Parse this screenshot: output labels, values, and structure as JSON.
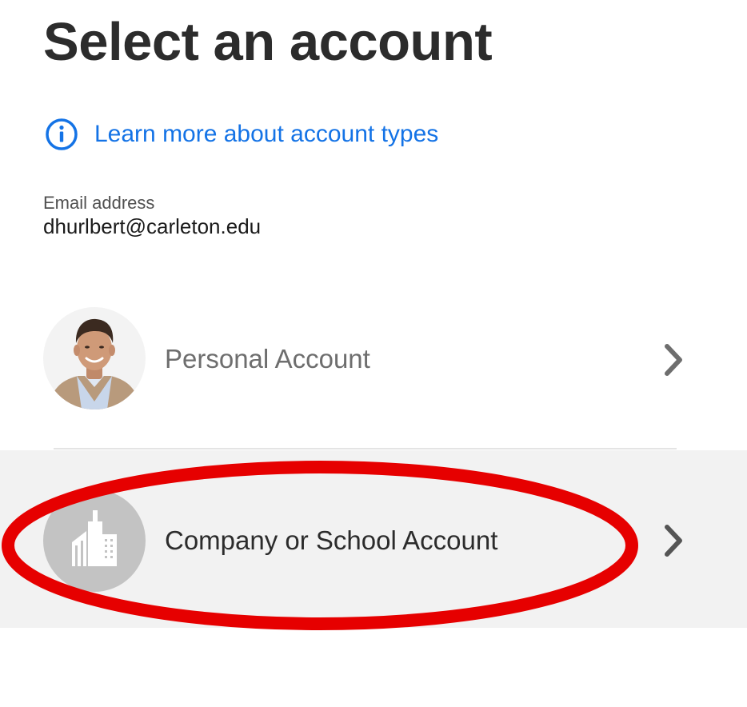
{
  "header": {
    "title": "Select an account"
  },
  "help": {
    "icon": "info-icon",
    "link_text": "Learn more about account types",
    "link_color": "#1473e6"
  },
  "email": {
    "label": "Email address",
    "value": "dhurlbert@carleton.edu"
  },
  "accounts": [
    {
      "label": "Personal Account",
      "avatar": "user-photo",
      "chevron": "chevron-right-icon"
    },
    {
      "label": "Company or School Account",
      "avatar": "building-icon",
      "chevron": "chevron-right-icon"
    }
  ],
  "annotation": {
    "shape": "ellipse",
    "color": "#e60000",
    "target": "Company or School Account"
  }
}
